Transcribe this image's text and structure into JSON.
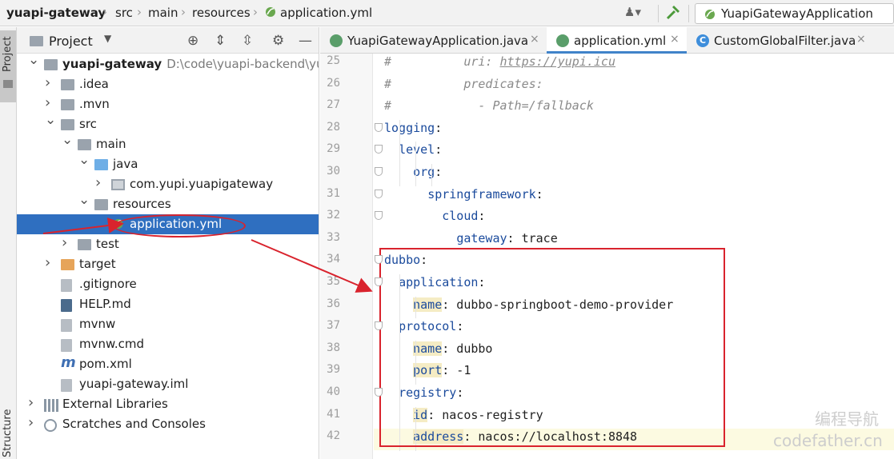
{
  "breadcrumb": [
    "yuapi-gateway",
    "src",
    "main",
    "resources",
    "application.yml"
  ],
  "run_config": "YuapiGatewayApplication",
  "project_panel": {
    "title": "Project",
    "rows": [
      {
        "label": "yuapi-gateway",
        "hint": "D:\\code\\yuapi-backend\\yua",
        "indent": 0,
        "arrow": "down",
        "icon": "folder-icon",
        "bold": true
      },
      {
        "label": ".idea",
        "indent": 1,
        "arrow": "right",
        "icon": "folder-icon"
      },
      {
        "label": ".mvn",
        "indent": 1,
        "arrow": "right",
        "icon": "folder-icon"
      },
      {
        "label": "src",
        "indent": 1,
        "arrow": "down",
        "icon": "folder-icon"
      },
      {
        "label": "main",
        "indent": 2,
        "arrow": "down",
        "icon": "folder-icon"
      },
      {
        "label": "java",
        "indent": 3,
        "arrow": "down",
        "icon": "source-folder-icon"
      },
      {
        "label": "com.yupi.yuapigateway",
        "indent": 4,
        "arrow": "right",
        "icon": "package-icon"
      },
      {
        "label": "resources",
        "indent": 3,
        "arrow": "down",
        "icon": "resources-folder-icon"
      },
      {
        "label": "application.yml",
        "indent": 4,
        "arrow": "",
        "icon": "spring-yml-icon",
        "selected": true
      },
      {
        "label": "test",
        "indent": 2,
        "arrow": "right",
        "icon": "folder-icon"
      },
      {
        "label": "target",
        "indent": 1,
        "arrow": "right",
        "icon": "excluded-folder-icon"
      },
      {
        "label": ".gitignore",
        "indent": 1,
        "arrow": "",
        "icon": "gitignore-icon"
      },
      {
        "label": "HELP.md",
        "indent": 1,
        "arrow": "",
        "icon": "markdown-icon"
      },
      {
        "label": "mvnw",
        "indent": 1,
        "arrow": "",
        "icon": "script-icon"
      },
      {
        "label": "mvnw.cmd",
        "indent": 1,
        "arrow": "",
        "icon": "script-icon"
      },
      {
        "label": "pom.xml",
        "indent": 1,
        "arrow": "",
        "icon": "maven-icon"
      },
      {
        "label": "yuapi-gateway.iml",
        "indent": 1,
        "arrow": "",
        "icon": "iml-icon"
      },
      {
        "label": "External Libraries",
        "indent": 0,
        "arrow": "right",
        "icon": "libraries-icon"
      },
      {
        "label": "Scratches and Consoles",
        "indent": 0,
        "arrow": "right",
        "icon": "scratches-icon"
      }
    ]
  },
  "side_strip": {
    "project": "Project",
    "structure": "Structure"
  },
  "tabs": [
    {
      "label": "YuapiGatewayApplication.java",
      "icon": "spring-class-icon",
      "active": false
    },
    {
      "label": "application.yml",
      "icon": "spring-yml-icon",
      "active": true
    },
    {
      "label": "CustomGlobalFilter.java",
      "icon": "class-icon",
      "active": false
    }
  ],
  "editor": {
    "lines": [
      {
        "n": "25",
        "text": "#          uri: https://yupi.icu",
        "kind": "comment"
      },
      {
        "n": "26",
        "text": "#          predicates:",
        "kind": "comment"
      },
      {
        "n": "27",
        "text": "#            - Path=/fallback",
        "kind": "comment"
      },
      {
        "n": "28",
        "key": "logging",
        "val": "",
        "indent": 0
      },
      {
        "n": "29",
        "key": "level",
        "val": "",
        "indent": 1
      },
      {
        "n": "30",
        "key": "org",
        "val": "",
        "indent": 2
      },
      {
        "n": "31",
        "key": "springframework",
        "val": "",
        "indent": 3
      },
      {
        "n": "32",
        "key": "cloud",
        "val": "",
        "indent": 4
      },
      {
        "n": "33",
        "key": "gateway",
        "val": "trace",
        "indent": 5
      },
      {
        "n": "34",
        "key": "dubbo",
        "val": "",
        "indent": 0
      },
      {
        "n": "35",
        "key": "application",
        "val": "",
        "indent": 1
      },
      {
        "n": "36",
        "key": "name",
        "val": "dubbo-springboot-demo-provider",
        "indent": 2,
        "marked": true
      },
      {
        "n": "37",
        "key": "protocol",
        "val": "",
        "indent": 1
      },
      {
        "n": "38",
        "key": "name",
        "val": "dubbo",
        "indent": 2,
        "marked": true
      },
      {
        "n": "39",
        "key": "port",
        "val": "-1",
        "indent": 2,
        "marked": true
      },
      {
        "n": "40",
        "key": "registry",
        "val": "",
        "indent": 1
      },
      {
        "n": "41",
        "key": "id",
        "val": "nacos-registry",
        "indent": 2,
        "marked": true
      },
      {
        "n": "42",
        "key": "address",
        "val": "nacos://localhost:8848",
        "indent": 2,
        "marked": true,
        "current": true
      }
    ]
  },
  "watermark": {
    "line1": "编程导航",
    "line2": "codefather.cn"
  },
  "colors": {
    "selection": "#2f6fc0",
    "annotation": "#d9232d",
    "key": "#1a4a9c"
  }
}
